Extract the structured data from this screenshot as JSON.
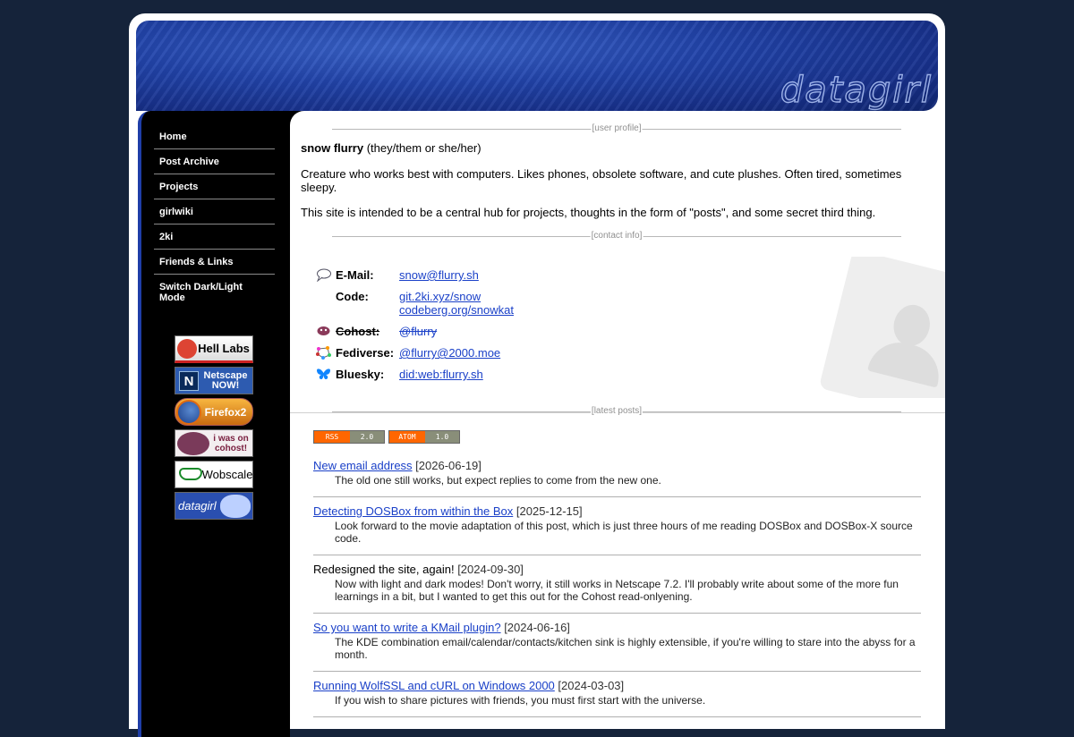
{
  "site": {
    "logo_text": "datagirl"
  },
  "nav": [
    "Home",
    "Post Archive",
    "Projects",
    "girlwiki",
    "2ki",
    "Friends & Links",
    "Switch Dark/Light Mode"
  ],
  "badges": {
    "hell": "Hell Labs",
    "netscape": "Netscape NOW!",
    "netscape_icon": "N",
    "firefox": "Firefox2",
    "cohost": "i was on cohost!",
    "wobscale": "Wobscale",
    "datagirl": "datagirl"
  },
  "sections": {
    "profile": "[user profile]",
    "contact": "[contact info]",
    "posts": "[latest posts]"
  },
  "profile": {
    "name": "snow flurry",
    "pronouns": "(they/them or she/her)",
    "bio": "Creature who works best with computers. Likes phones, obsolete software, and cute plushes. Often tired, sometimes sleepy.",
    "about": "This site is intended to be a central hub for projects, thoughts in the form of \"posts\", and some secret third thing."
  },
  "contact": [
    {
      "icon": "speech-bubble-icon",
      "key": "E-Mail:",
      "values": [
        "snow@flurry.sh"
      ],
      "strike": false
    },
    {
      "icon": "",
      "key": "Code:",
      "values": [
        "git.2ki.xyz/snow",
        "codeberg.org/snowkat"
      ],
      "strike": false
    },
    {
      "icon": "cohost-eggbug-icon",
      "key": "Cohost:",
      "values": [
        "@flurry"
      ],
      "strike": true
    },
    {
      "icon": "fediverse-icon",
      "key": "Fediverse:",
      "values": [
        "@flurry@2000.moe"
      ],
      "strike": false
    },
    {
      "icon": "bluesky-butterfly-icon",
      "key": "Bluesky:",
      "values": [
        "did:web:flurry.sh"
      ],
      "strike": false
    }
  ],
  "feeds": {
    "rss_left": "RSS",
    "rss_right": "2.0",
    "atom_left": "ATOM",
    "atom_right": "1.0"
  },
  "posts": [
    {
      "title": "New email address",
      "link": true,
      "date": "[2026-06-19]",
      "desc": "The old one still works, but expect replies to come from the new one."
    },
    {
      "title": "Detecting DOSBox from within the Box",
      "link": true,
      "date": "[2025-12-15]",
      "desc": "Look forward to the movie adaptation of this post, which is just three hours of me reading DOSBox and DOSBox-X source code."
    },
    {
      "title": "Redesigned the site, again!",
      "link": false,
      "date": "[2024-09-30]",
      "desc": "Now with light and dark modes! Don't worry, it still works in Netscape 7.2. I'll probably write about some of the more fun learnings in a bit, but I wanted to get this out for the Cohost read-onlyening."
    },
    {
      "title": "So you want to write a KMail plugin?",
      "link": true,
      "date": "[2024-06-16]",
      "desc": "The KDE combination email/calendar/contacts/kitchen sink is highly extensible, if you're willing to stare into the abyss for a month."
    },
    {
      "title": "Running WolfSSL and cURL on Windows 2000",
      "link": true,
      "date": "[2024-03-03]",
      "desc": "If you wish to share pictures with friends, you must first start with the universe."
    }
  ],
  "colors": {
    "background": "#15233a",
    "banner": "#2244aa",
    "link": "#1a40c8",
    "sidebar": "#000000"
  }
}
